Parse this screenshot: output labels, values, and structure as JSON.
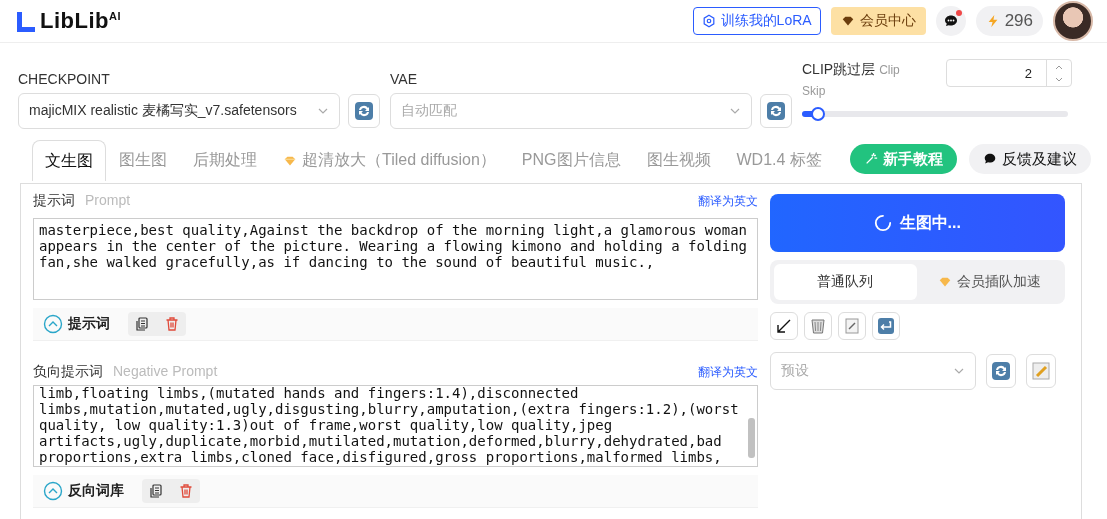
{
  "header": {
    "logo": "LibLib",
    "logo_sup": "AI",
    "lora_button": "训练我的LoRA",
    "member_button": "会员中心",
    "messages": {
      "unread": true
    },
    "points": "296"
  },
  "settings": {
    "checkpoint": {
      "label": "CHECKPOINT",
      "value": "majicMIX realistic 麦橘写实_v7.safetensors"
    },
    "vae": {
      "label": "VAE",
      "placeholder": "自动匹配"
    },
    "clip": {
      "label": "CLIP跳过层",
      "sublabel": "Clip Skip",
      "value": "2",
      "level": 0.06
    }
  },
  "tabs": [
    {
      "label": "文生图",
      "selected": true,
      "premium": false
    },
    {
      "label": "图生图",
      "selected": false,
      "premium": false
    },
    {
      "label": "后期处理",
      "selected": false,
      "premium": false
    },
    {
      "label": "超清放大（Tiled diffusion）",
      "selected": false,
      "premium": true
    },
    {
      "label": "PNG图片信息",
      "selected": false,
      "premium": false
    },
    {
      "label": "图生视频",
      "selected": false,
      "premium": false
    },
    {
      "label": "WD1.4 标签",
      "selected": false,
      "premium": false
    }
  ],
  "tutorial_button": "新手教程",
  "feedback_button": "反馈及建议",
  "prompt": {
    "label": "提示词",
    "sublabel": "Prompt",
    "translate": "翻译为英文",
    "text": "masterpiece,best quality,Against the backdrop of the morning light,a glamorous woman\nappears in the center of the picture. Wearing a flowing kimono and holding a folding\nfan,she walked gracefully,as if dancing to the sound of beautiful music.,",
    "toggle": "提示词"
  },
  "negative": {
    "label": "负向提示词",
    "sublabel": "Negative Prompt",
    "translate": "翻译为英文",
    "text": "limb,floating limbs,(mutated hands and fingers:1.4),disconnected\nlimbs,mutation,mutated,ugly,disgusting,blurry,amputation,(extra fingers:1.2),(worst\nquality, low quality:1.3)out of frame,worst quality,low quality,jpeg\nartifacts,ugly,duplicate,morbid,mutilated,mutation,deformed,blurry,dehydrated,bad\nproportions,extra limbs,cloned face,disfigured,gross proportions,malformed limbs,",
    "toggle": "反向词库"
  },
  "generate": {
    "label": "生图中...",
    "loading": true
  },
  "queues": [
    {
      "label": "普通队列",
      "selected": true,
      "premium": false
    },
    {
      "label": "会员插队加速",
      "selected": false,
      "premium": true
    }
  ],
  "preset": {
    "placeholder": "预设"
  }
}
